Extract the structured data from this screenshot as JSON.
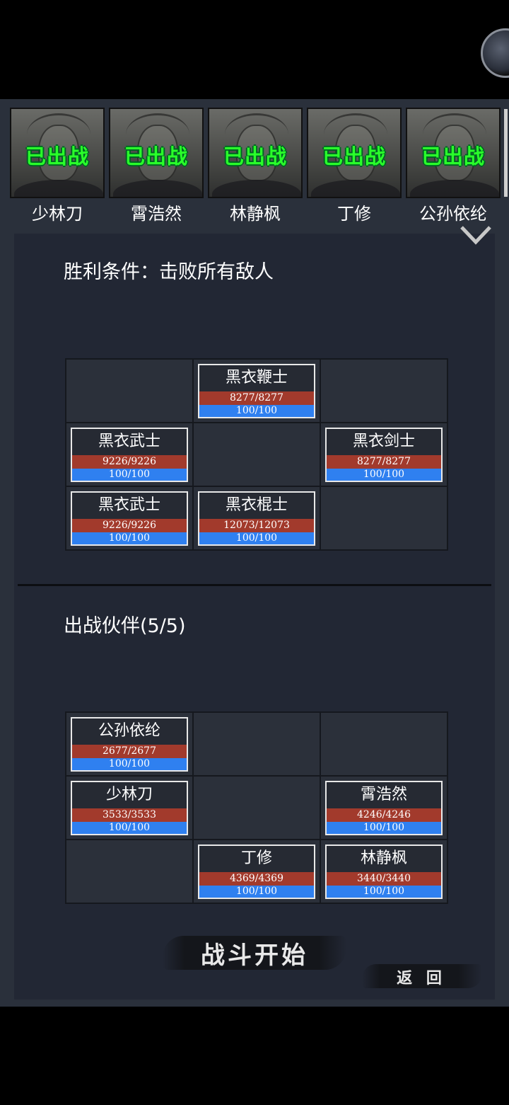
{
  "roster": [
    {
      "name": "少林刀",
      "status": "已出战"
    },
    {
      "name": "霄浩然",
      "status": "已出战"
    },
    {
      "name": "林静枫",
      "status": "已出战"
    },
    {
      "name": "丁修",
      "status": "已出战"
    },
    {
      "name": "公孙依纶",
      "status": "已出战"
    }
  ],
  "victory_condition": "胜利条件：击败所有敌人",
  "enemy_grid": [
    {
      "name": "",
      "hp": "",
      "mp": ""
    },
    {
      "name": "黑衣鞭士",
      "hp": "8277/8277",
      "mp": "100/100"
    },
    {
      "name": "",
      "hp": "",
      "mp": ""
    },
    {
      "name": "黑衣武士",
      "hp": "9226/9226",
      "mp": "100/100"
    },
    {
      "name": "",
      "hp": "",
      "mp": ""
    },
    {
      "name": "黑衣剑士",
      "hp": "8277/8277",
      "mp": "100/100"
    },
    {
      "name": "黑衣武士",
      "hp": "9226/9226",
      "mp": "100/100"
    },
    {
      "name": "黑衣棍士",
      "hp": "12073/12073",
      "mp": "100/100"
    },
    {
      "name": "",
      "hp": "",
      "mp": ""
    }
  ],
  "party_title": "出战伙伴(5/5)",
  "party_grid": [
    {
      "name": "公孙依纶",
      "hp": "2677/2677",
      "mp": "100/100"
    },
    {
      "name": "",
      "hp": "",
      "mp": ""
    },
    {
      "name": "",
      "hp": "",
      "mp": ""
    },
    {
      "name": "少林刀",
      "hp": "3533/3533",
      "mp": "100/100"
    },
    {
      "name": "",
      "hp": "",
      "mp": ""
    },
    {
      "name": "霄浩然",
      "hp": "4246/4246",
      "mp": "100/100"
    },
    {
      "name": "",
      "hp": "",
      "mp": ""
    },
    {
      "name": "丁修",
      "hp": "4369/4369",
      "mp": "100/100"
    },
    {
      "name": "林静枫",
      "hp": "3440/3440",
      "mp": "100/100"
    }
  ],
  "buttons": {
    "start": "战斗开始",
    "back": "返 回"
  },
  "colors": {
    "deployed_tag": "#2aff2a",
    "hp_bar": "#a23a2c",
    "mp_bar": "#2f80f0",
    "panel_bg": "#222734"
  },
  "icons": {
    "collapse": "chevron-down-icon"
  }
}
